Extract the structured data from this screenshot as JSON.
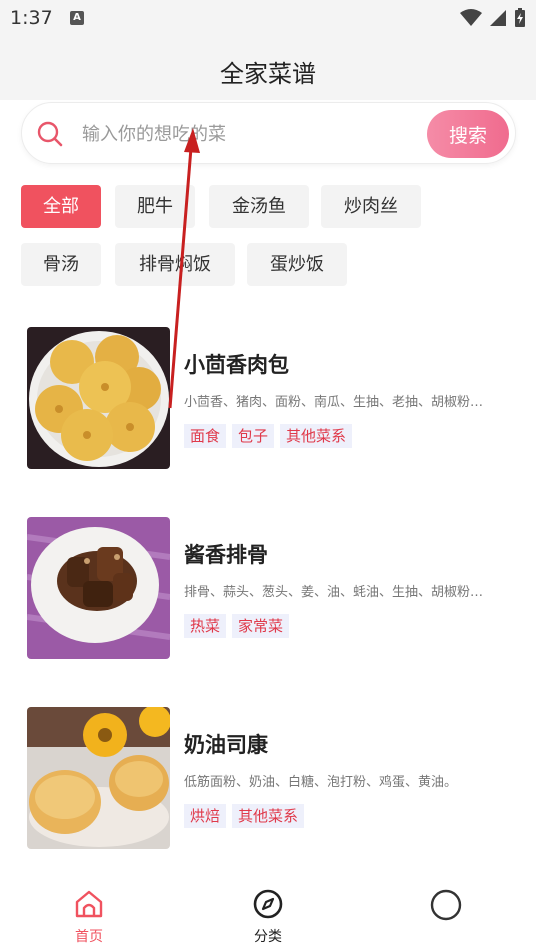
{
  "status": {
    "time": "1:37",
    "badge": "A"
  },
  "header": {
    "title": "全家菜谱"
  },
  "search": {
    "placeholder": "输入你的想吃的菜",
    "value": "",
    "button_label": "搜索"
  },
  "categories": [
    "全部",
    "肥牛",
    "金汤鱼",
    "炒肉丝",
    "骨汤",
    "排骨焖饭",
    "蛋炒饭"
  ],
  "recipes": [
    {
      "name": "小茴香肉包",
      "ingredients": "小茴香、猪肉、面粉、南瓜、生抽、老抽、胡椒粉…",
      "tags": [
        "面食",
        "包子",
        "其他菜系"
      ]
    },
    {
      "name": "酱香排骨",
      "ingredients": "排骨、蒜头、葱头、姜、油、蚝油、生抽、胡椒粉…",
      "tags": [
        "热菜",
        "家常菜"
      ]
    },
    {
      "name": "奶油司康",
      "ingredients": "低筋面粉、奶油、白糖、泡打粉、鸡蛋、黄油。",
      "tags": [
        "烘焙",
        "其他菜系"
      ]
    }
  ],
  "tabbar": [
    {
      "label": "首页",
      "icon": "home-icon",
      "active": true
    },
    {
      "label": "分类",
      "icon": "compass-icon",
      "active": false
    },
    {
      "label": "",
      "icon": "circle-icon",
      "active": false
    }
  ],
  "colors": {
    "accent": "#f0525f",
    "tag_text": "#e0394a",
    "tag_bg": "#eef0fb",
    "search_button": "#f06b8e"
  }
}
